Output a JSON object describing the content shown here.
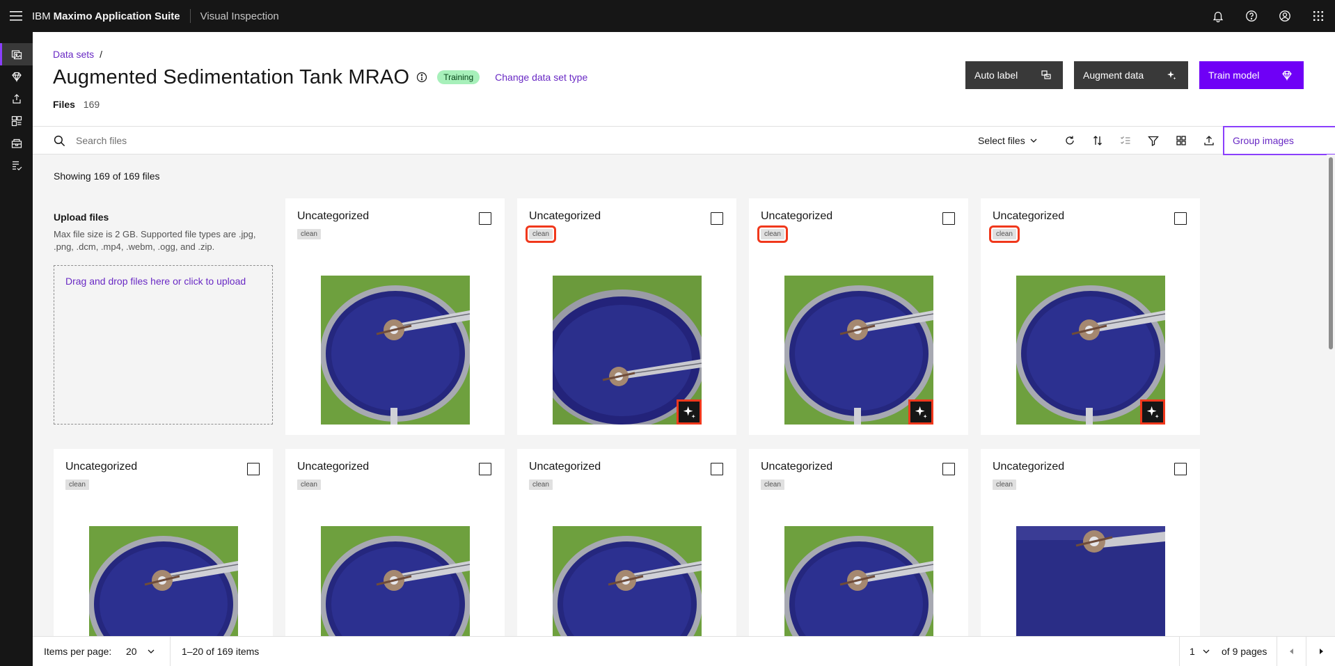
{
  "header": {
    "brand_prefix": "IBM",
    "brand_name": "Maximo Application Suite",
    "product": "Visual Inspection"
  },
  "breadcrumb": {
    "link": "Data sets",
    "separator": "/"
  },
  "page": {
    "title": "Augmented Sedimentation Tank MRAO",
    "status_tag": "Training",
    "change_link": "Change data set type",
    "files_label": "Files",
    "files_count": "169"
  },
  "actions": {
    "auto_label": "Auto label",
    "augment_data": "Augment data",
    "train_model": "Train model"
  },
  "toolbar": {
    "search_placeholder": "Search files",
    "select_files": "Select files",
    "group_images": "Group images"
  },
  "showing": "Showing 169 of 169 files",
  "upload": {
    "title": "Upload files",
    "description": "Max file size is 2 GB. Supported file types are .jpg, .png, .dcm, .mp4, .webm, .ogg, and .zip.",
    "drop_text": "Drag and drop files here or click to upload"
  },
  "cards": [
    {
      "category": "Uncategorized",
      "tag": "clean",
      "augmented": false,
      "highlighted": false
    },
    {
      "category": "Uncategorized",
      "tag": "clean",
      "augmented": true,
      "highlighted": true
    },
    {
      "category": "Uncategorized",
      "tag": "clean",
      "augmented": true,
      "highlighted": true
    },
    {
      "category": "Uncategorized",
      "tag": "clean",
      "augmented": true,
      "highlighted": true
    },
    {
      "category": "Uncategorized",
      "tag": "clean",
      "augmented": false,
      "highlighted": false
    },
    {
      "category": "Uncategorized",
      "tag": "clean",
      "augmented": false,
      "highlighted": false
    },
    {
      "category": "Uncategorized",
      "tag": "clean",
      "augmented": false,
      "highlighted": false
    },
    {
      "category": "Uncategorized",
      "tag": "clean",
      "augmented": false,
      "highlighted": false
    },
    {
      "category": "Uncategorized",
      "tag": "clean",
      "augmented": false,
      "highlighted": false
    }
  ],
  "pagination": {
    "items_per_page_label": "Items per page:",
    "items_per_page": "20",
    "range": "1–20 of 169 items",
    "page": "1",
    "of_pages": "of 9 pages"
  },
  "colors": {
    "header_bg": "#161616",
    "accent": "#6f00f6",
    "link": "#6929c4",
    "training_tag": "#a7f0ba",
    "highlight": "#f0381c"
  },
  "icons": {
    "header": [
      "notification-icon",
      "help-icon",
      "user-avatar-icon",
      "app-switcher-icon"
    ],
    "rail": [
      "data-sets-icon",
      "models-icon",
      "deploy-icon",
      "dashboard-icon",
      "inventory-icon",
      "reports-icon"
    ],
    "toolbar": [
      "refresh-icon",
      "sort-icon",
      "checklist-icon",
      "filter-icon",
      "grid-view-icon",
      "upload-icon"
    ]
  }
}
